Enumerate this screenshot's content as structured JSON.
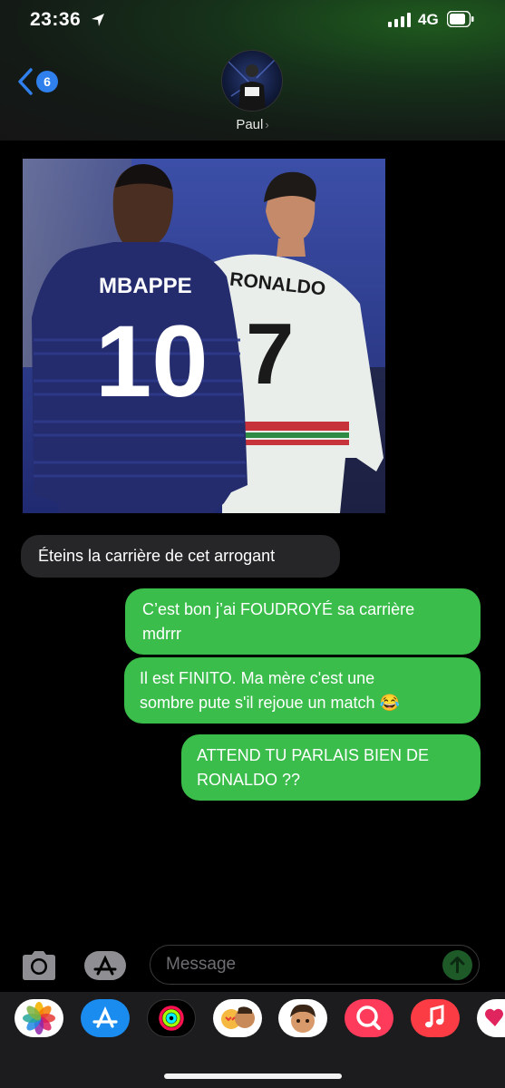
{
  "status_bar": {
    "time": "23:36",
    "network": "4G"
  },
  "header": {
    "back_badge": "6",
    "contact_name": "Paul"
  },
  "photo": {
    "left_jersey_name": "MBAPPE",
    "left_jersey_number": "10",
    "right_jersey_name": "RONALDO",
    "right_jersey_number": "7"
  },
  "messages": [
    {
      "direction": "received",
      "text": "Éteins la carrière de cet arrogant"
    },
    {
      "direction": "sent",
      "lines": [
        "C’est bon j’ai FOUDROYÉ sa carrière",
        "mdrrr"
      ]
    },
    {
      "direction": "sent",
      "lines": [
        "Il est FINITO. Ma mère c'est une",
        "sombre pute s'il rejoue un match 😂"
      ]
    },
    {
      "direction": "sent",
      "lines": [
        "ATTEND TU PARLAIS BIEN DE",
        "RONALDO ??"
      ]
    }
  ],
  "composer": {
    "placeholder": "Message"
  },
  "app_drawer": [
    "photos-icon",
    "app-store-icon",
    "activity-icon",
    "memoji-stickers-icon",
    "memoji-icon",
    "images-search-icon",
    "music-icon",
    "heart-app-icon"
  ],
  "colors": {
    "sent_bubble": "#3bbd4b",
    "received_bubble": "#262628",
    "accent": "#2f80ed"
  }
}
